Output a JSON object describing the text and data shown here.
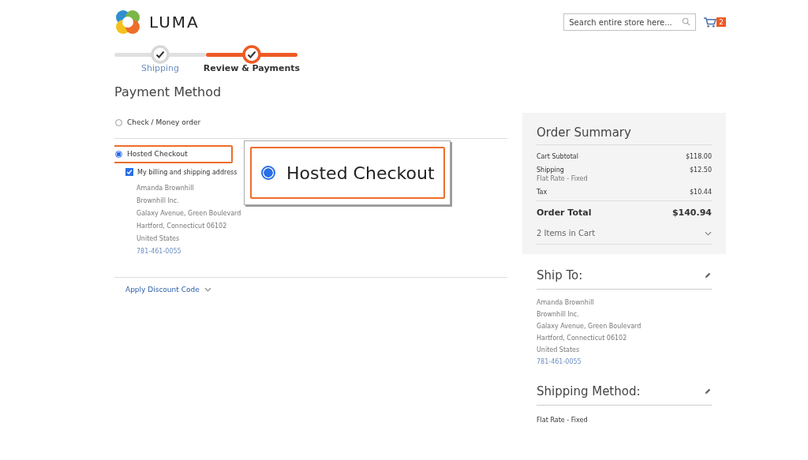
{
  "header": {
    "logo": "LUMA",
    "search": {
      "placeholder": "Search entire store here..."
    },
    "cart_count": "2"
  },
  "progress": [
    {
      "label": "Shipping",
      "selected": false
    },
    {
      "label": "Review & Payments",
      "selected": true
    }
  ],
  "payment": {
    "title": "Payment Method",
    "methods": [
      {
        "label": "Check / Money order",
        "selected": false,
        "highlighted": false
      },
      {
        "label": "Hosted Checkout",
        "selected": true,
        "highlighted": true
      }
    ],
    "same_address": {
      "label": "My billing and shipping address",
      "checked": true
    },
    "address": [
      "Amanda Brownhill",
      "Brownhill Inc.",
      "Galaxy Avenue, Green Boulevard",
      "Hartford, Connecticut 06102",
      "United States"
    ],
    "phone": "781-461-0055",
    "discount": "Apply Discount Code",
    "callout": {
      "label": "Hosted Checkout",
      "selected": true
    }
  },
  "summary": {
    "title": "Order Summary",
    "rows": [
      {
        "label": "Cart Subtotal",
        "value": "$118.00"
      },
      {
        "label": "Shipping",
        "note": "Flat Rate - Fixed",
        "value": "$12.50"
      },
      {
        "label": "Tax",
        "value": "$10.44"
      }
    ],
    "total": {
      "label": "Order Total",
      "value": "$140.94"
    },
    "items": "2 Items in Cart"
  },
  "ship_to": {
    "title": "Ship To:",
    "address": [
      "Amanda Brownhill",
      "Brownhill Inc.",
      "Galaxy Avenue, Green Boulevard",
      "Hartford, Connecticut 06102",
      "United States"
    ],
    "phone": "781-461-0055"
  },
  "shipping_method": {
    "title": "Shipping Method:",
    "value": "Flat Rate - Fixed"
  }
}
